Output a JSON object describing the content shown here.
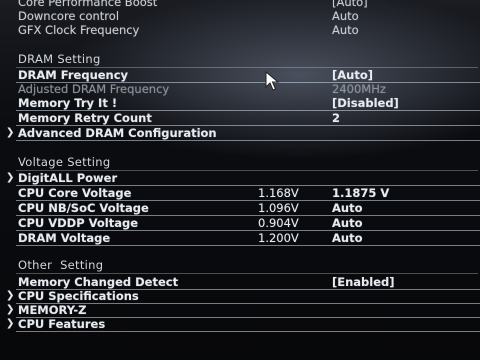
{
  "top_rows": [
    {
      "label": "Core Performance Boost",
      "value": "[Auto]"
    },
    {
      "label": "Downcore control",
      "value": "Auto"
    },
    {
      "label": "GFX Clock Frequency",
      "value": "Auto"
    }
  ],
  "dram_setting": {
    "title": "DRAM Setting",
    "rows": [
      {
        "label": "DRAM Frequency",
        "value": "[Auto]"
      },
      {
        "label": "Adjusted DRAM Frequency",
        "value": "2400MHz"
      },
      {
        "label": "Memory Try It !",
        "value": "[Disabled]"
      },
      {
        "label": "Memory Retry Count",
        "value": "2"
      },
      {
        "label": "Advanced DRAM Configuration"
      }
    ]
  },
  "voltage_setting": {
    "title": "Voltage Setting",
    "rows": [
      {
        "label": "DigitALL Power"
      },
      {
        "label": "CPU Core Voltage",
        "current": "1.168V",
        "value": "1.1875 V"
      },
      {
        "label": "CPU NB/SoC Voltage",
        "current": "1.096V",
        "value": "Auto"
      },
      {
        "label": "CPU VDDP Voltage",
        "current": "0.904V",
        "value": "Auto"
      },
      {
        "label": "DRAM Voltage",
        "current": "1.200V",
        "value": "Auto"
      }
    ]
  },
  "other_setting": {
    "title": "Other  Setting",
    "rows": [
      {
        "label": "Memory Changed Detect",
        "value": "[Enabled]"
      },
      {
        "label": "CPU Specifications"
      },
      {
        "label": "MEMORY-Z"
      },
      {
        "label": "CPU Features"
      }
    ]
  },
  "icons": {
    "submenu_arrow": "chevron-right-icon",
    "pointer": "mouse-pointer-icon"
  },
  "colors": {
    "background": "#07080a",
    "text": "#e6ebf2",
    "dim_text": "#8a9099"
  }
}
